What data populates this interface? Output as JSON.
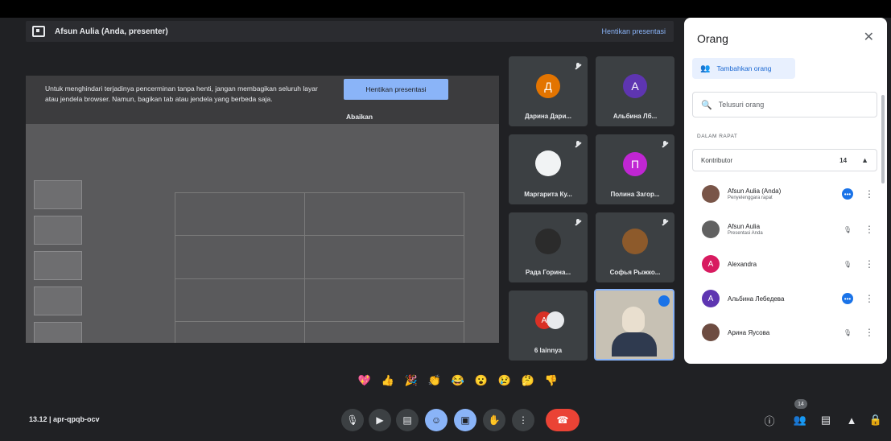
{
  "presenter_bar": {
    "name": "Afsun Aulia (Anda, presenter)",
    "stop_link": "Hentikan presentasi"
  },
  "shared_screen": {
    "notice": "Untuk menghindari terjadinya pencerminan tanpa henti, jangan membagikan seluruh layar atau jendela browser. Namun, bagikan tab atau jendela yang berbeda saja.",
    "stop_button": "Hentikan presentasi",
    "ignore": "Abaikan"
  },
  "tiles": [
    {
      "name": "Дарина Дари...",
      "initial": "Д",
      "color": "#e37400"
    },
    {
      "name": "Альбина Лб...",
      "initial": "А",
      "color": "#5e35b1"
    },
    {
      "name": "Маргарита Ку...",
      "initial": "",
      "color": "#f1f3f4"
    },
    {
      "name": "Полина Загор...",
      "initial": "П",
      "color": "#c026d3"
    },
    {
      "name": "Рада Горина...",
      "initial": "",
      "color": "#3c4043"
    },
    {
      "name": "Софья Рыжко...",
      "initial": "",
      "color": "#8d5a2b"
    },
    {
      "name": "6 lainnya",
      "initial": "A",
      "color": "#d93025"
    }
  ],
  "people_panel": {
    "title": "Orang",
    "add_people": "Tambahkan orang",
    "search_placeholder": "Telusuri orang",
    "section": "DALAM RAPAT",
    "contributors_label": "Kontributor",
    "contributors_count": "14",
    "people": [
      {
        "name": "Afsun Aulia (Anda)",
        "sub": "Penyelenggara rapat",
        "initial": "",
        "color": "#795548",
        "status": "blue"
      },
      {
        "name": "Afsun Aulia",
        "sub": "Presentasi Anda",
        "initial": "",
        "color": "#616161",
        "status": "gray"
      },
      {
        "name": "Alexandra",
        "sub": "",
        "initial": "A",
        "color": "#d81b60",
        "status": "gray"
      },
      {
        "name": "Альбина Лебедева",
        "sub": "",
        "initial": "A",
        "color": "#5e35b1",
        "status": "blue"
      },
      {
        "name": "Арина Яусова",
        "sub": "",
        "initial": "",
        "color": "#6d4c41",
        "status": "gray"
      }
    ]
  },
  "bottom_bar": {
    "clock": "13.12 | apr-qpqb-ocv",
    "participant_badge": "14"
  }
}
